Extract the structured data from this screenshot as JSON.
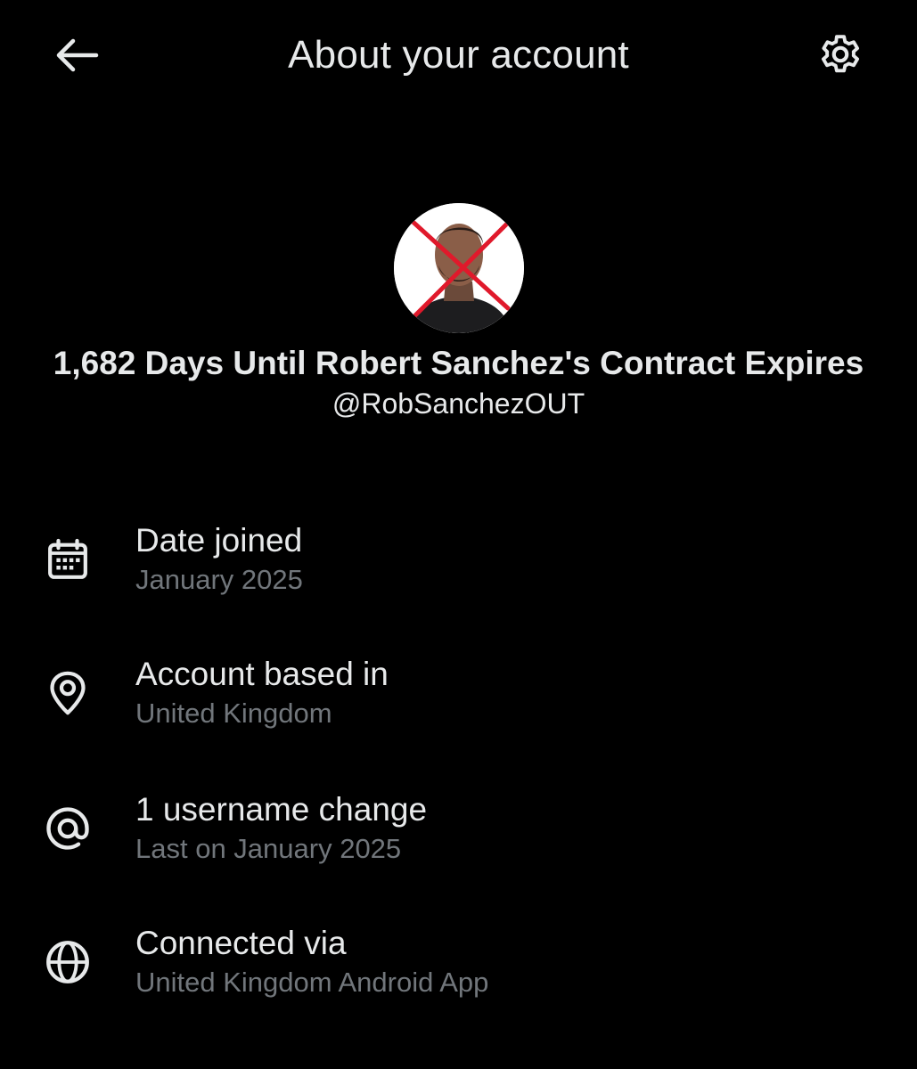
{
  "header": {
    "title": "About your account",
    "back_icon": "arrow-left-icon",
    "settings_icon": "gear-icon"
  },
  "profile": {
    "display_name": "1,682 Days Until Robert Sanchez's Contract Expires",
    "handle": "@RobSanchezOUT",
    "avatar_icon": "avatar-crossed-out"
  },
  "info": {
    "items": [
      {
        "icon": "calendar-icon",
        "label": "Date joined",
        "value": "January 2025"
      },
      {
        "icon": "location-pin-icon",
        "label": "Account based in",
        "value": "United Kingdom"
      },
      {
        "icon": "at-sign-icon",
        "label": "1 username change",
        "value": "Last on January 2025"
      },
      {
        "icon": "globe-icon",
        "label": "Connected via",
        "value": "United Kingdom Android App"
      }
    ]
  },
  "colors": {
    "background": "#000000",
    "primary_text": "#e7e9ea",
    "secondary_text": "#71767b",
    "cross_red": "#e0192b"
  }
}
